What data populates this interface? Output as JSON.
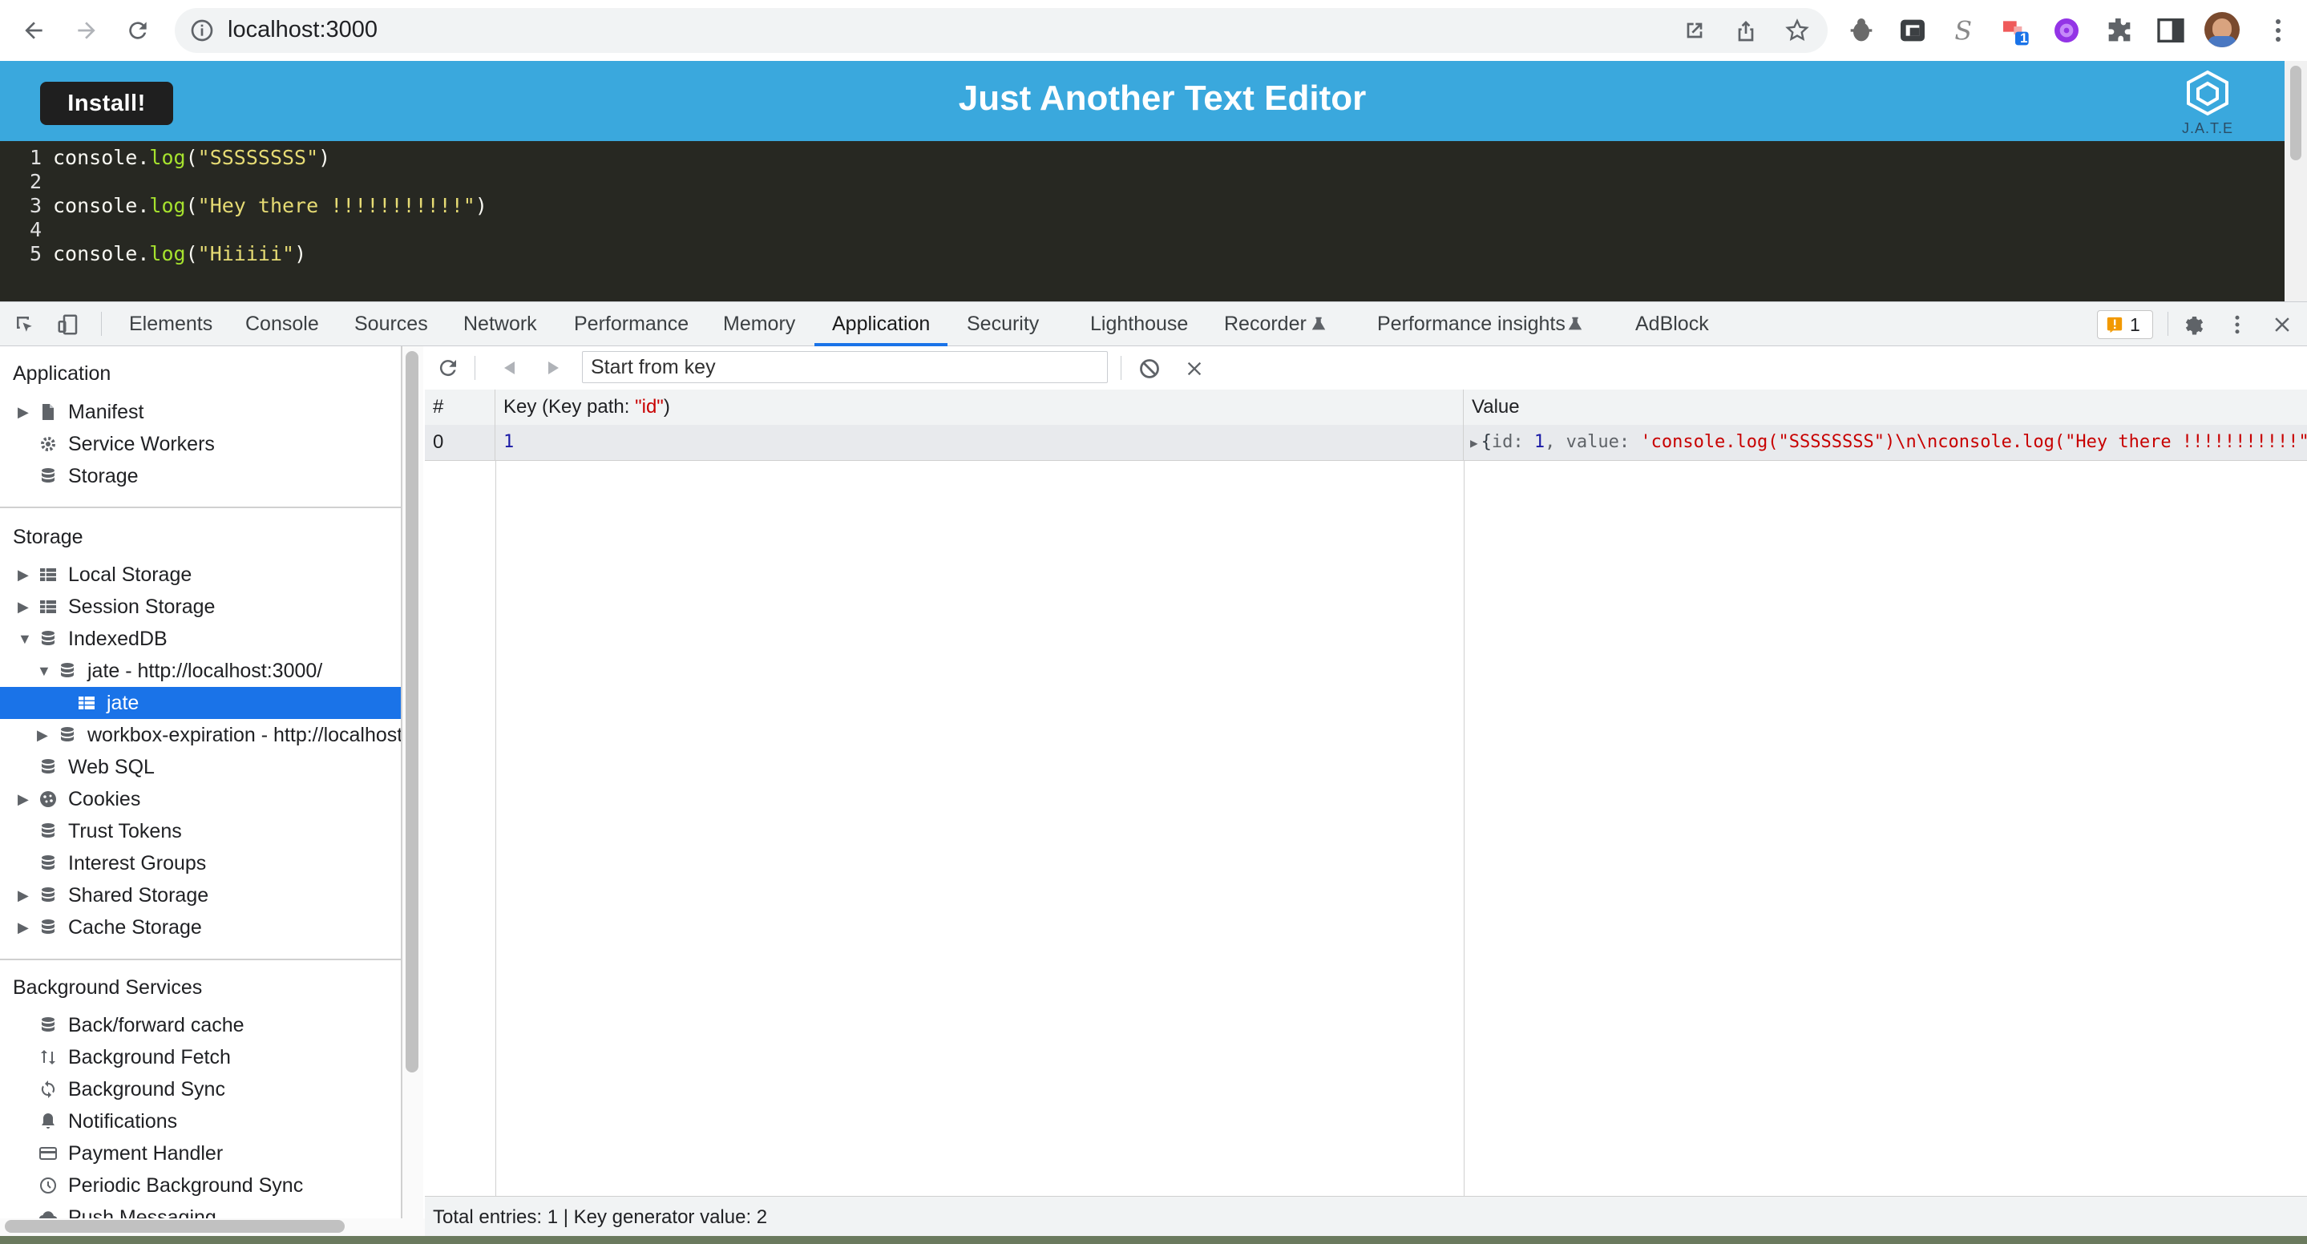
{
  "browser": {
    "url": "localhost:3000",
    "extension_badge": "1"
  },
  "app": {
    "install_label": "Install!",
    "title": "Just Another Text Editor",
    "logo_text": "J.A.T.E",
    "header_color": "#3aa8dd"
  },
  "editor": {
    "lines": [
      {
        "num": "1",
        "obj": "console",
        "fn": "log",
        "str": "\"SSSSSSSS\""
      },
      {
        "num": "2"
      },
      {
        "num": "3",
        "obj": "console",
        "fn": "log",
        "str": "\"Hey there !!!!!!!!!!!\""
      },
      {
        "num": "4"
      },
      {
        "num": "5",
        "obj": "console",
        "fn": "log",
        "str": "\"Hiiiii\""
      }
    ]
  },
  "devtools": {
    "tabs": [
      "Elements",
      "Console",
      "Sources",
      "Network",
      "Performance",
      "Memory",
      "Application",
      "Security",
      "Lighthouse",
      "Recorder",
      "Performance insights",
      "AdBlock"
    ],
    "active_tab": "Application",
    "issues_count": "1"
  },
  "sidebar": {
    "application_title": "Application",
    "application_items": [
      "Manifest",
      "Service Workers",
      "Storage"
    ],
    "storage_title": "Storage",
    "storage_items": [
      "Local Storage",
      "Session Storage",
      "IndexedDB",
      "jate - http://localhost:3000/",
      "jate",
      "workbox-expiration - http://localhost:3000/",
      "Web SQL",
      "Cookies",
      "Trust Tokens",
      "Interest Groups",
      "Shared Storage",
      "Cache Storage"
    ],
    "background_title": "Background Services",
    "background_items": [
      "Back/forward cache",
      "Background Fetch",
      "Background Sync",
      "Notifications",
      "Payment Handler",
      "Periodic Background Sync",
      "Push Messaging"
    ]
  },
  "main": {
    "key_placeholder": "Start from key",
    "columns": {
      "index": "#",
      "key_prefix": "Key (Key path: ",
      "key_path": "\"id\"",
      "key_suffix": ")",
      "value": "Value"
    },
    "row": {
      "index": "0",
      "key": "1",
      "value_open": "{",
      "value_id_label": "id: ",
      "value_id": "1",
      "value_sep": ", value: ",
      "value_str": "'console.log(\"SSSSSSSS\")\\n\\nconsole.log(\"Hey there !!!!!!!!!!!\")\\n\\nconsole.log(\"Hiiiii\")'}"
    },
    "status": "Total entries: 1 | Key generator value: 2"
  }
}
